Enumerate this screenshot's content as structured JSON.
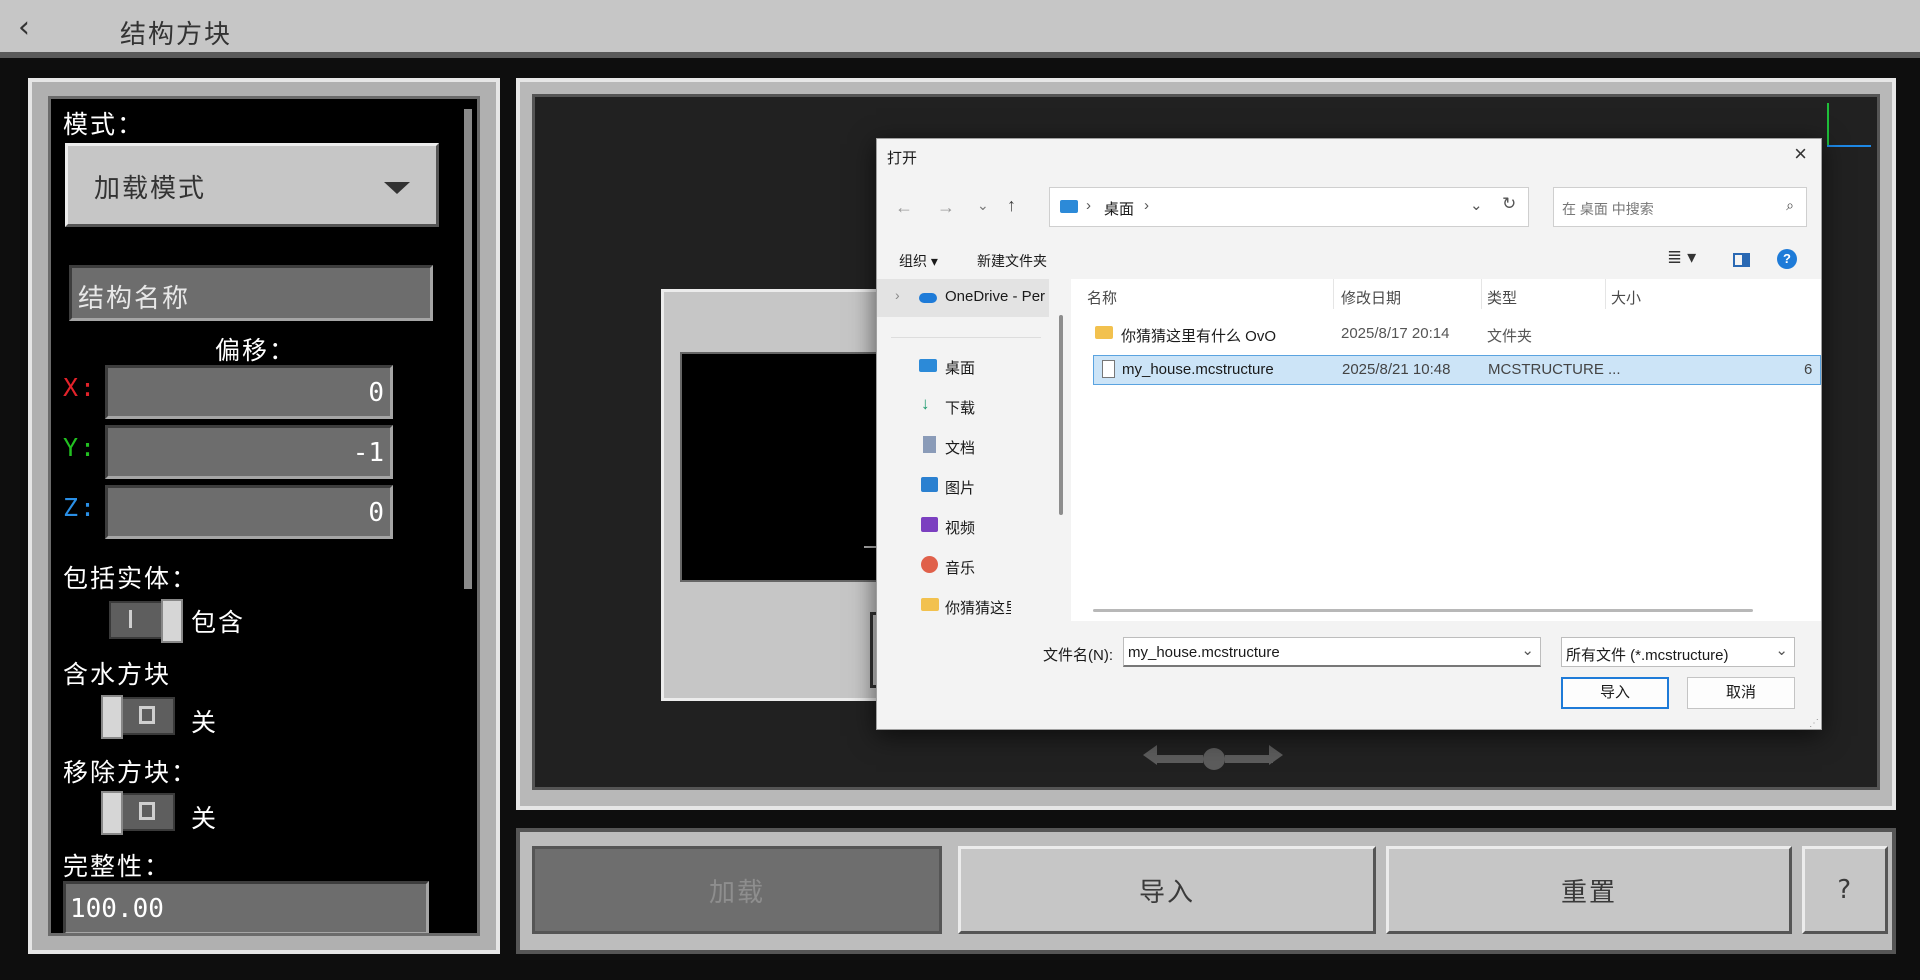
{
  "topbar": {
    "title": "结构方块",
    "back_glyph": "‹"
  },
  "left": {
    "mode_label": "模式：",
    "mode_value": "加载模式",
    "structure_name_placeholder": "结构名称",
    "offset_label": "偏移：",
    "offset": {
      "x_label": "X:",
      "x": "0",
      "y_label": "Y:",
      "y": "-1",
      "z_label": "Z:",
      "z": "0"
    },
    "entities_label": "包括实体：",
    "entities_value": "包含",
    "waterlog_label": "含水方块",
    "waterlog_value": "关",
    "remove_label": "移除方块：",
    "remove_value": "关",
    "integrity_label": "完整性：",
    "integrity_value": "100.00"
  },
  "bottom": {
    "load": "加载",
    "import": "导入",
    "reset": "重置",
    "help": "?"
  },
  "dialog": {
    "title": "打开",
    "path_root": "桌面",
    "search_placeholder": "在 桌面 中搜索",
    "organize": "组织",
    "new_folder": "新建文件夹",
    "columns": {
      "name": "名称",
      "date": "修改日期",
      "type": "类型",
      "size": "大小"
    },
    "sidebar": {
      "onedrive": "OneDrive - Per",
      "items": [
        {
          "label": "桌面",
          "icon": "desktop-icon"
        },
        {
          "label": "下载",
          "icon": "download-icon"
        },
        {
          "label": "文档",
          "icon": "document-icon"
        },
        {
          "label": "图片",
          "icon": "pictures-icon"
        },
        {
          "label": "视频",
          "icon": "video-icon"
        },
        {
          "label": "音乐",
          "icon": "music-icon"
        },
        {
          "label": "你猜猜这里有",
          "icon": "folder-icon"
        }
      ]
    },
    "files": [
      {
        "name": "你猜猜这里有什么 OvO",
        "date": "2025/8/17 20:14",
        "type": "文件夹",
        "size": ""
      },
      {
        "name": "my_house.mcstructure",
        "date": "2025/8/21 10:48",
        "type": "MCSTRUCTURE ...",
        "size": "6"
      }
    ],
    "filename_label": "文件名(N):",
    "filename_value": "my_house.mcstructure",
    "filter_value": "所有文件 (*.mcstructure)",
    "import_button": "导入",
    "cancel_button": "取消"
  }
}
